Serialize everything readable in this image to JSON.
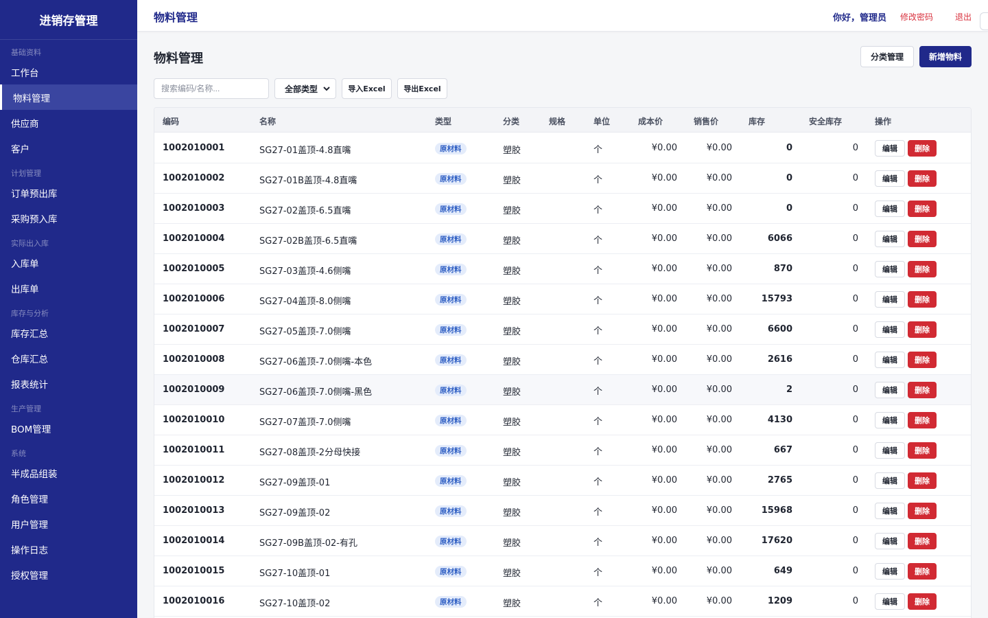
{
  "brand": "进销存管理",
  "sidebar": {
    "groups": [
      {
        "label": "基础资料",
        "items": [
          {
            "label": "工作台"
          },
          {
            "label": "物料管理",
            "active": true
          },
          {
            "label": "供应商"
          },
          {
            "label": "客户"
          }
        ]
      },
      {
        "label": "计划管理",
        "items": [
          {
            "label": "订单预出库"
          },
          {
            "label": "采购预入库"
          }
        ]
      },
      {
        "label": "实际出入库",
        "items": [
          {
            "label": "入库单"
          },
          {
            "label": "出库单"
          }
        ]
      },
      {
        "label": "库存与分析",
        "items": [
          {
            "label": "库存汇总"
          },
          {
            "label": "仓库汇总"
          },
          {
            "label": "报表统计"
          }
        ]
      },
      {
        "label": "生产管理",
        "items": [
          {
            "label": "BOM管理"
          }
        ]
      },
      {
        "label": "系统",
        "items": [
          {
            "label": "半成品组装"
          },
          {
            "label": "角色管理"
          },
          {
            "label": "用户管理"
          },
          {
            "label": "操作日志"
          },
          {
            "label": "授权管理"
          }
        ]
      }
    ]
  },
  "topbar": {
    "title": "物料管理",
    "greeting": "你好，管理员",
    "change_password": "修改密码",
    "logout": "退出"
  },
  "page": {
    "title": "物料管理",
    "category_button": "分类管理",
    "add_button": "新增物料"
  },
  "toolbar": {
    "search_placeholder": "搜索编码/名称...",
    "type_select": "全部类型",
    "import_label": "导入Excel",
    "export_label": "导出Excel"
  },
  "table": {
    "columns": [
      "编码",
      "名称",
      "类型",
      "分类",
      "规格",
      "单位",
      "成本价",
      "销售价",
      "库存",
      "安全库存",
      "操作"
    ],
    "edit_label": "编辑",
    "delete_label": "删除",
    "rows": [
      {
        "code": "1002010001",
        "name": "SG27-01盖顶-4.8直嘴",
        "type": "原材料",
        "category": "塑胶",
        "spec": "",
        "unit": "个",
        "cost": "¥0.00",
        "price": "¥0.00",
        "stock": "0",
        "safety": "0"
      },
      {
        "code": "1002010002",
        "name": "SG27-01B盖顶-4.8直嘴",
        "type": "原材料",
        "category": "塑胶",
        "spec": "",
        "unit": "个",
        "cost": "¥0.00",
        "price": "¥0.00",
        "stock": "0",
        "safety": "0"
      },
      {
        "code": "1002010003",
        "name": "SG27-02盖顶-6.5直嘴",
        "type": "原材料",
        "category": "塑胶",
        "spec": "",
        "unit": "个",
        "cost": "¥0.00",
        "price": "¥0.00",
        "stock": "0",
        "safety": "0"
      },
      {
        "code": "1002010004",
        "name": "SG27-02B盖顶-6.5直嘴",
        "type": "原材料",
        "category": "塑胶",
        "spec": "",
        "unit": "个",
        "cost": "¥0.00",
        "price": "¥0.00",
        "stock": "6066",
        "safety": "0"
      },
      {
        "code": "1002010005",
        "name": "SG27-03盖顶-4.6侧嘴",
        "type": "原材料",
        "category": "塑胶",
        "spec": "",
        "unit": "个",
        "cost": "¥0.00",
        "price": "¥0.00",
        "stock": "870",
        "safety": "0"
      },
      {
        "code": "1002010006",
        "name": "SG27-04盖顶-8.0侧嘴",
        "type": "原材料",
        "category": "塑胶",
        "spec": "",
        "unit": "个",
        "cost": "¥0.00",
        "price": "¥0.00",
        "stock": "15793",
        "safety": "0"
      },
      {
        "code": "1002010007",
        "name": "SG27-05盖顶-7.0侧嘴",
        "type": "原材料",
        "category": "塑胶",
        "spec": "",
        "unit": "个",
        "cost": "¥0.00",
        "price": "¥0.00",
        "stock": "6600",
        "safety": "0"
      },
      {
        "code": "1002010008",
        "name": "SG27-06盖顶-7.0侧嘴-本色",
        "type": "原材料",
        "category": "塑胶",
        "spec": "",
        "unit": "个",
        "cost": "¥0.00",
        "price": "¥0.00",
        "stock": "2616",
        "safety": "0"
      },
      {
        "code": "1002010009",
        "name": "SG27-06盖顶-7.0侧嘴-黑色",
        "type": "原材料",
        "category": "塑胶",
        "spec": "",
        "unit": "个",
        "cost": "¥0.00",
        "price": "¥0.00",
        "stock": "2",
        "safety": "0",
        "hover": true
      },
      {
        "code": "1002010010",
        "name": "SG27-07盖顶-7.0侧嘴",
        "type": "原材料",
        "category": "塑胶",
        "spec": "",
        "unit": "个",
        "cost": "¥0.00",
        "price": "¥0.00",
        "stock": "4130",
        "safety": "0"
      },
      {
        "code": "1002010011",
        "name": "SG27-08盖顶-2分母快接",
        "type": "原材料",
        "category": "塑胶",
        "spec": "",
        "unit": "个",
        "cost": "¥0.00",
        "price": "¥0.00",
        "stock": "667",
        "safety": "0"
      },
      {
        "code": "1002010012",
        "name": "SG27-09盖顶-01",
        "type": "原材料",
        "category": "塑胶",
        "spec": "",
        "unit": "个",
        "cost": "¥0.00",
        "price": "¥0.00",
        "stock": "2765",
        "safety": "0"
      },
      {
        "code": "1002010013",
        "name": "SG27-09盖顶-02",
        "type": "原材料",
        "category": "塑胶",
        "spec": "",
        "unit": "个",
        "cost": "¥0.00",
        "price": "¥0.00",
        "stock": "15968",
        "safety": "0"
      },
      {
        "code": "1002010014",
        "name": "SG27-09B盖顶-02-有孔",
        "type": "原材料",
        "category": "塑胶",
        "spec": "",
        "unit": "个",
        "cost": "¥0.00",
        "price": "¥0.00",
        "stock": "17620",
        "safety": "0"
      },
      {
        "code": "1002010015",
        "name": "SG27-10盖顶-01",
        "type": "原材料",
        "category": "塑胶",
        "spec": "",
        "unit": "个",
        "cost": "¥0.00",
        "price": "¥0.00",
        "stock": "649",
        "safety": "0"
      },
      {
        "code": "1002010016",
        "name": "SG27-10盖顶-02",
        "type": "原材料",
        "category": "塑胶",
        "spec": "",
        "unit": "个",
        "cost": "¥0.00",
        "price": "¥0.00",
        "stock": "1209",
        "safety": "0"
      }
    ]
  },
  "colors": {
    "sidebar_bg": "#20298a",
    "primary": "#20298a",
    "danger": "#d12a33",
    "badge_bg": "#e4ecfb",
    "badge_text": "#2f5fc4"
  }
}
